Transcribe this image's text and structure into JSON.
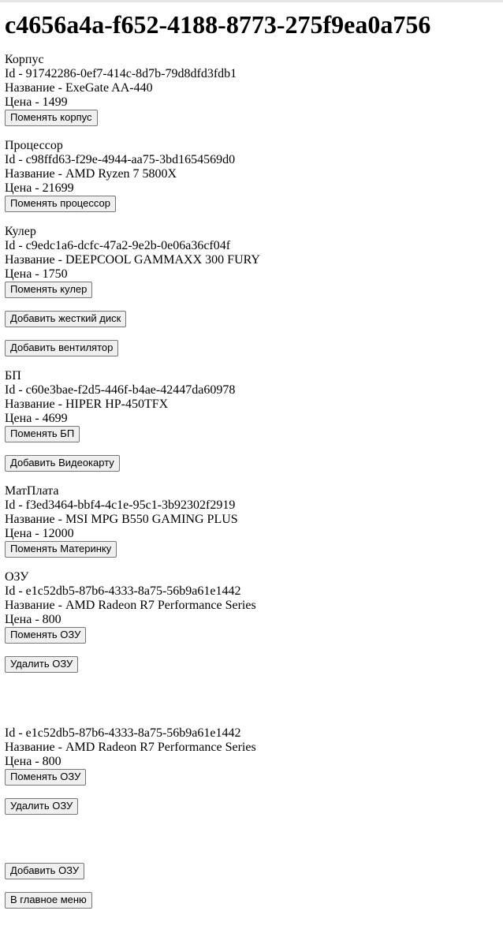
{
  "build_id": "c4656a4a-f652-4188-8773-275f9ea0a756",
  "case": {
    "heading": "Корпус",
    "id_line": "Id - 91742286-0ef7-414c-8d7b-79d8dfd3fdb1",
    "name_line": "Название - ExeGate AA-440",
    "price_line": "Цена - 1499",
    "button": "Поменять корпус"
  },
  "cpu": {
    "heading": "Процессор",
    "id_line": "Id - c98ffd63-f29e-4944-aa75-3bd1654569d0",
    "name_line": "Название - AMD Ryzen 7 5800X",
    "price_line": "Цена - 21699",
    "button": "Поменять процессор"
  },
  "cooler": {
    "heading": "Кулер",
    "id_line": "Id - c9edc1a6-dcfc-47a2-9e2b-0e06a36cf04f",
    "name_line": "Название - DEEPCOOL GAMMAXX 300 FURY",
    "price_line": "Цена - 1750",
    "button": "Поменять кулер"
  },
  "add_hdd_button": "Добавить жесткий диск",
  "add_fan_button": "Добавить вентилятор",
  "psu": {
    "heading": "БП",
    "id_line": "Id - c60e3bae-f2d5-446f-b4ae-42447da60978",
    "name_line": "Название - HIPER HP-450TFX",
    "price_line": "Цена - 4699",
    "button": "Поменять БП"
  },
  "add_gpu_button": "Добавить Видеокарту",
  "motherboard": {
    "heading": "МатПлата",
    "id_line": "Id - f3ed3464-bbf4-4c1e-95c1-3b92302f2919",
    "name_line": "Название - MSI MPG B550 GAMING PLUS",
    "price_line": "Цена - 12000",
    "button": "Поменять Материнку"
  },
  "ram_heading": "ОЗУ",
  "ram": [
    {
      "id_line": "Id - e1c52db5-87b6-4333-8a75-56b9a61e1442",
      "name_line": "Название - AMD Radeon R7 Performance Series",
      "price_line": "Цена - 800",
      "change_button": "Поменять ОЗУ",
      "delete_button": "Удалить ОЗУ"
    },
    {
      "id_line": "Id - e1c52db5-87b6-4333-8a75-56b9a61e1442",
      "name_line": "Название - AMD Radeon R7 Performance Series",
      "price_line": "Цена - 800",
      "change_button": "Поменять ОЗУ",
      "delete_button": "Удалить ОЗУ"
    }
  ],
  "add_ram_button": "Добавить ОЗУ",
  "main_menu_button": "В главное меню"
}
